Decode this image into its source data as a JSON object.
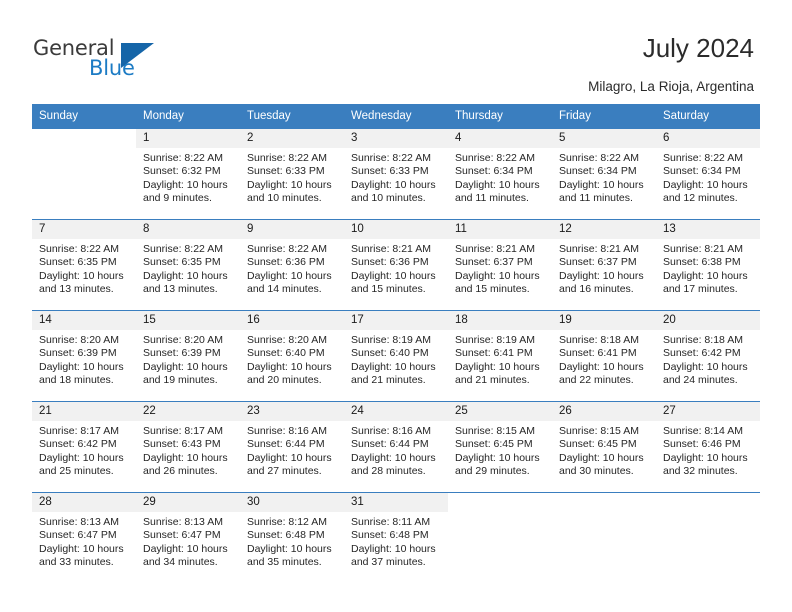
{
  "brand": {
    "name_primary": "General",
    "name_secondary": "Blue",
    "triangle_color": "#1565a8",
    "accent_color": "#3a7ebf"
  },
  "header": {
    "title": "July 2024",
    "location": "Milagro, La Rioja, Argentina"
  },
  "calendar": {
    "weekday_headers": [
      "Sunday",
      "Monday",
      "Tuesday",
      "Wednesday",
      "Thursday",
      "Friday",
      "Saturday"
    ],
    "weeks": [
      [
        {
          "day": "",
          "lines": []
        },
        {
          "day": "1",
          "lines": [
            "Sunrise: 8:22 AM",
            "Sunset: 6:32 PM",
            "Daylight: 10 hours",
            "and 9 minutes."
          ]
        },
        {
          "day": "2",
          "lines": [
            "Sunrise: 8:22 AM",
            "Sunset: 6:33 PM",
            "Daylight: 10 hours",
            "and 10 minutes."
          ]
        },
        {
          "day": "3",
          "lines": [
            "Sunrise: 8:22 AM",
            "Sunset: 6:33 PM",
            "Daylight: 10 hours",
            "and 10 minutes."
          ]
        },
        {
          "day": "4",
          "lines": [
            "Sunrise: 8:22 AM",
            "Sunset: 6:34 PM",
            "Daylight: 10 hours",
            "and 11 minutes."
          ]
        },
        {
          "day": "5",
          "lines": [
            "Sunrise: 8:22 AM",
            "Sunset: 6:34 PM",
            "Daylight: 10 hours",
            "and 11 minutes."
          ]
        },
        {
          "day": "6",
          "lines": [
            "Sunrise: 8:22 AM",
            "Sunset: 6:34 PM",
            "Daylight: 10 hours",
            "and 12 minutes."
          ]
        }
      ],
      [
        {
          "day": "7",
          "lines": [
            "Sunrise: 8:22 AM",
            "Sunset: 6:35 PM",
            "Daylight: 10 hours",
            "and 13 minutes."
          ]
        },
        {
          "day": "8",
          "lines": [
            "Sunrise: 8:22 AM",
            "Sunset: 6:35 PM",
            "Daylight: 10 hours",
            "and 13 minutes."
          ]
        },
        {
          "day": "9",
          "lines": [
            "Sunrise: 8:22 AM",
            "Sunset: 6:36 PM",
            "Daylight: 10 hours",
            "and 14 minutes."
          ]
        },
        {
          "day": "10",
          "lines": [
            "Sunrise: 8:21 AM",
            "Sunset: 6:36 PM",
            "Daylight: 10 hours",
            "and 15 minutes."
          ]
        },
        {
          "day": "11",
          "lines": [
            "Sunrise: 8:21 AM",
            "Sunset: 6:37 PM",
            "Daylight: 10 hours",
            "and 15 minutes."
          ]
        },
        {
          "day": "12",
          "lines": [
            "Sunrise: 8:21 AM",
            "Sunset: 6:37 PM",
            "Daylight: 10 hours",
            "and 16 minutes."
          ]
        },
        {
          "day": "13",
          "lines": [
            "Sunrise: 8:21 AM",
            "Sunset: 6:38 PM",
            "Daylight: 10 hours",
            "and 17 minutes."
          ]
        }
      ],
      [
        {
          "day": "14",
          "lines": [
            "Sunrise: 8:20 AM",
            "Sunset: 6:39 PM",
            "Daylight: 10 hours",
            "and 18 minutes."
          ]
        },
        {
          "day": "15",
          "lines": [
            "Sunrise: 8:20 AM",
            "Sunset: 6:39 PM",
            "Daylight: 10 hours",
            "and 19 minutes."
          ]
        },
        {
          "day": "16",
          "lines": [
            "Sunrise: 8:20 AM",
            "Sunset: 6:40 PM",
            "Daylight: 10 hours",
            "and 20 minutes."
          ]
        },
        {
          "day": "17",
          "lines": [
            "Sunrise: 8:19 AM",
            "Sunset: 6:40 PM",
            "Daylight: 10 hours",
            "and 21 minutes."
          ]
        },
        {
          "day": "18",
          "lines": [
            "Sunrise: 8:19 AM",
            "Sunset: 6:41 PM",
            "Daylight: 10 hours",
            "and 21 minutes."
          ]
        },
        {
          "day": "19",
          "lines": [
            "Sunrise: 8:18 AM",
            "Sunset: 6:41 PM",
            "Daylight: 10 hours",
            "and 22 minutes."
          ]
        },
        {
          "day": "20",
          "lines": [
            "Sunrise: 8:18 AM",
            "Sunset: 6:42 PM",
            "Daylight: 10 hours",
            "and 24 minutes."
          ]
        }
      ],
      [
        {
          "day": "21",
          "lines": [
            "Sunrise: 8:17 AM",
            "Sunset: 6:42 PM",
            "Daylight: 10 hours",
            "and 25 minutes."
          ]
        },
        {
          "day": "22",
          "lines": [
            "Sunrise: 8:17 AM",
            "Sunset: 6:43 PM",
            "Daylight: 10 hours",
            "and 26 minutes."
          ]
        },
        {
          "day": "23",
          "lines": [
            "Sunrise: 8:16 AM",
            "Sunset: 6:44 PM",
            "Daylight: 10 hours",
            "and 27 minutes."
          ]
        },
        {
          "day": "24",
          "lines": [
            "Sunrise: 8:16 AM",
            "Sunset: 6:44 PM",
            "Daylight: 10 hours",
            "and 28 minutes."
          ]
        },
        {
          "day": "25",
          "lines": [
            "Sunrise: 8:15 AM",
            "Sunset: 6:45 PM",
            "Daylight: 10 hours",
            "and 29 minutes."
          ]
        },
        {
          "day": "26",
          "lines": [
            "Sunrise: 8:15 AM",
            "Sunset: 6:45 PM",
            "Daylight: 10 hours",
            "and 30 minutes."
          ]
        },
        {
          "day": "27",
          "lines": [
            "Sunrise: 8:14 AM",
            "Sunset: 6:46 PM",
            "Daylight: 10 hours",
            "and 32 minutes."
          ]
        }
      ],
      [
        {
          "day": "28",
          "lines": [
            "Sunrise: 8:13 AM",
            "Sunset: 6:47 PM",
            "Daylight: 10 hours",
            "and 33 minutes."
          ]
        },
        {
          "day": "29",
          "lines": [
            "Sunrise: 8:13 AM",
            "Sunset: 6:47 PM",
            "Daylight: 10 hours",
            "and 34 minutes."
          ]
        },
        {
          "day": "30",
          "lines": [
            "Sunrise: 8:12 AM",
            "Sunset: 6:48 PM",
            "Daylight: 10 hours",
            "and 35 minutes."
          ]
        },
        {
          "day": "31",
          "lines": [
            "Sunrise: 8:11 AM",
            "Sunset: 6:48 PM",
            "Daylight: 10 hours",
            "and 37 minutes."
          ]
        },
        {
          "day": "",
          "lines": []
        },
        {
          "day": "",
          "lines": []
        },
        {
          "day": "",
          "lines": []
        }
      ]
    ]
  }
}
